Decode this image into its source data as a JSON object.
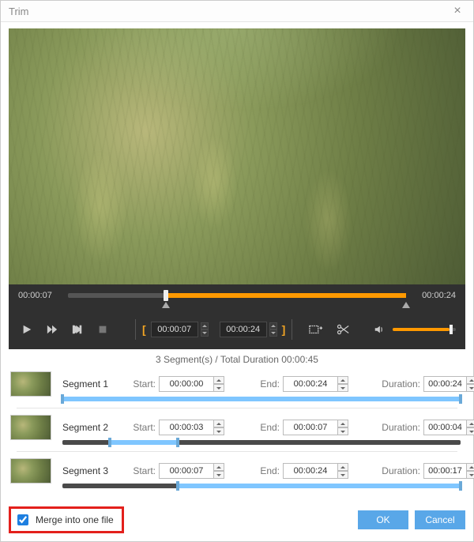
{
  "window": {
    "title": "Trim"
  },
  "preview": {
    "current_time": "00:00:07",
    "end_time": "00:00:24",
    "in_time": "00:00:07",
    "out_time": "00:00:24",
    "playhead_pct": 29,
    "select_start_pct": 29,
    "select_end_pct": 100,
    "volume_pct": 90
  },
  "summary": {
    "count": 3,
    "label_prefix": "Segment(s) / Total Duration",
    "total_duration": "00:00:45"
  },
  "labels": {
    "start": "Start:",
    "end": "End:",
    "duration": "Duration:",
    "merge": "Merge into one file",
    "ok": "OK",
    "cancel": "Cancel"
  },
  "segments": [
    {
      "name": "Segment 1",
      "start": "00:00:00",
      "end": "00:00:24",
      "duration": "00:00:24",
      "sel_start_pct": 0,
      "sel_end_pct": 100
    },
    {
      "name": "Segment 2",
      "start": "00:00:03",
      "end": "00:00:07",
      "duration": "00:00:04",
      "sel_start_pct": 12,
      "sel_end_pct": 29
    },
    {
      "name": "Segment 3",
      "start": "00:00:07",
      "end": "00:00:24",
      "duration": "00:00:17",
      "sel_start_pct": 29,
      "sel_end_pct": 100
    }
  ],
  "merge_checked": true
}
